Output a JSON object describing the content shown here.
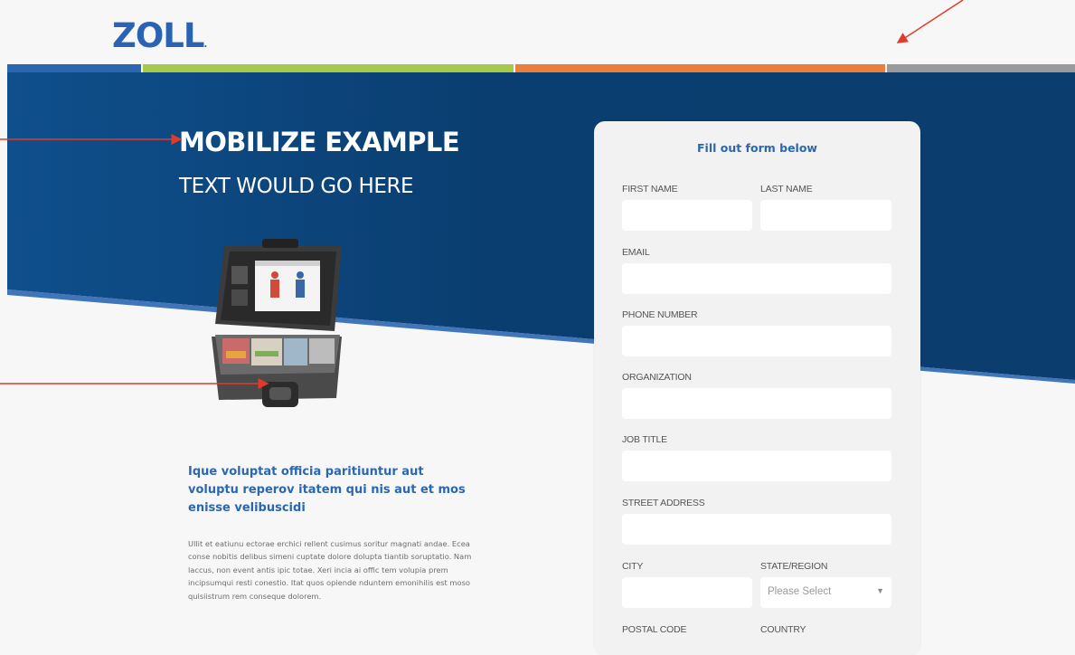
{
  "header": {
    "logo_text": "ZOLL",
    "logo_dot": ".",
    "stripe_colors": [
      "#2b67b1",
      "#a6c94b",
      "#ea7e3c",
      "#9a9a9a"
    ]
  },
  "hero": {
    "headline_1": "MOBILIZE EXAMPLE",
    "headline_2": "TEXT WOULD GO HERE",
    "background_color": "#0d4577"
  },
  "content": {
    "subhead": "Ique voluptat officia paritiuntur aut voluptu reperov itatem qui nis aut et mos enisse velibuscidi",
    "body": "Ullit et eatiunu ectorae erchici rellent cusimus soritur magnati andae. Ecea conse nobitis delibus simeni cuptate dolore dolupta tiantib soruptatio. Nam laccus, non event antis ipic totae. Xeri incia ai offic tem volupia prem incipsumqui resti conestio. Itat quos opiende nduntem emonihilis est moso quisiistrum rem conseque dolorem."
  },
  "form": {
    "title": "Fill out form below",
    "labels": {
      "first_name": "FIRST NAME",
      "last_name": "LAST NAME",
      "email": "EMAIL",
      "phone": "PHONE NUMBER",
      "organization": "ORGANIZATION",
      "job_title": "JOB TITLE",
      "street": "STREET ADDRESS",
      "city": "CITY",
      "state": "STATE/REGION",
      "postal": "POSTAL CODE",
      "country": "COUNTRY"
    },
    "state_placeholder": "Please Select"
  },
  "annotation_color": "#e03a2a"
}
